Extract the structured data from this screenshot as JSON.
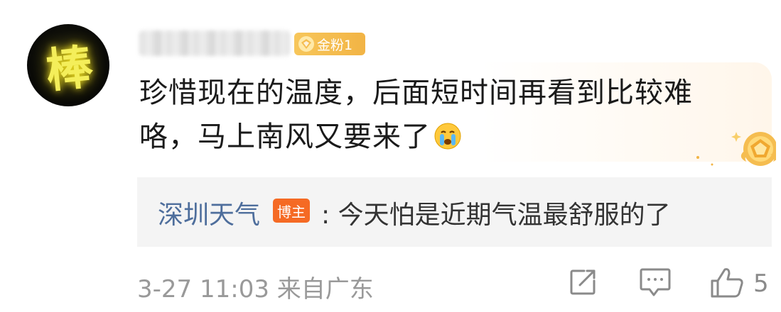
{
  "comment": {
    "avatar_glyph": "棒",
    "fan_badge": {
      "label": "金粉1",
      "color": "#f5bd50"
    },
    "text": "珍惜现在的温度，后面短时间再看到比较难咯，马上南风又要来了",
    "emoji": "crying-face",
    "medal_icon": "gold-medal"
  },
  "reply": {
    "author": "深圳天气",
    "badge": "博主",
    "text": ": 今天怕是近期气温最舒服的了",
    "author_color": "#4e6e9c",
    "badge_color": "#f56a24"
  },
  "footer": {
    "timestamp": "3-27 11:03 来自广东",
    "like_count": "5"
  }
}
